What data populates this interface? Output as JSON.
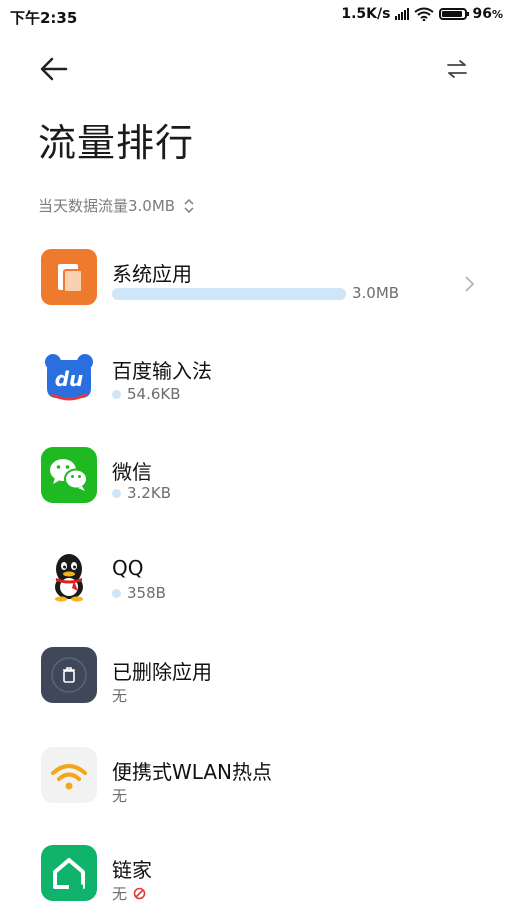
{
  "status_bar": {
    "time": "下午2:35",
    "speed": "1.5K/s",
    "battery": "96"
  },
  "header": {
    "title": "流量排行",
    "filter_label": "当天数据流量3.0MB"
  },
  "apps": [
    {
      "name": "系统应用",
      "usage": "3.0MB",
      "icon": "system-apps-icon",
      "usage_fraction": 1.0
    },
    {
      "name": "百度输入法",
      "usage": "54.6KB",
      "icon": "baidu-ime-icon"
    },
    {
      "name": "微信",
      "usage": "3.2KB",
      "icon": "wechat-icon"
    },
    {
      "name": "QQ",
      "usage": "358B",
      "icon": "qq-icon"
    },
    {
      "name": "已删除应用",
      "usage": "无",
      "icon": "deleted-apps-icon"
    },
    {
      "name": "便携式WLAN热点",
      "usage": "无",
      "icon": "wlan-hotspot-icon"
    },
    {
      "name": "链家",
      "usage": "无",
      "icon": "lianjia-icon"
    }
  ],
  "colors": {
    "bar": "#cfe6f9",
    "system_icon_bg": "#ee7a2d",
    "wechat_green": "#1fb922",
    "lianjia_green": "#0fb36b",
    "deleted_bg": "#3f4858",
    "baidu_blue": "#2a6fe0"
  }
}
